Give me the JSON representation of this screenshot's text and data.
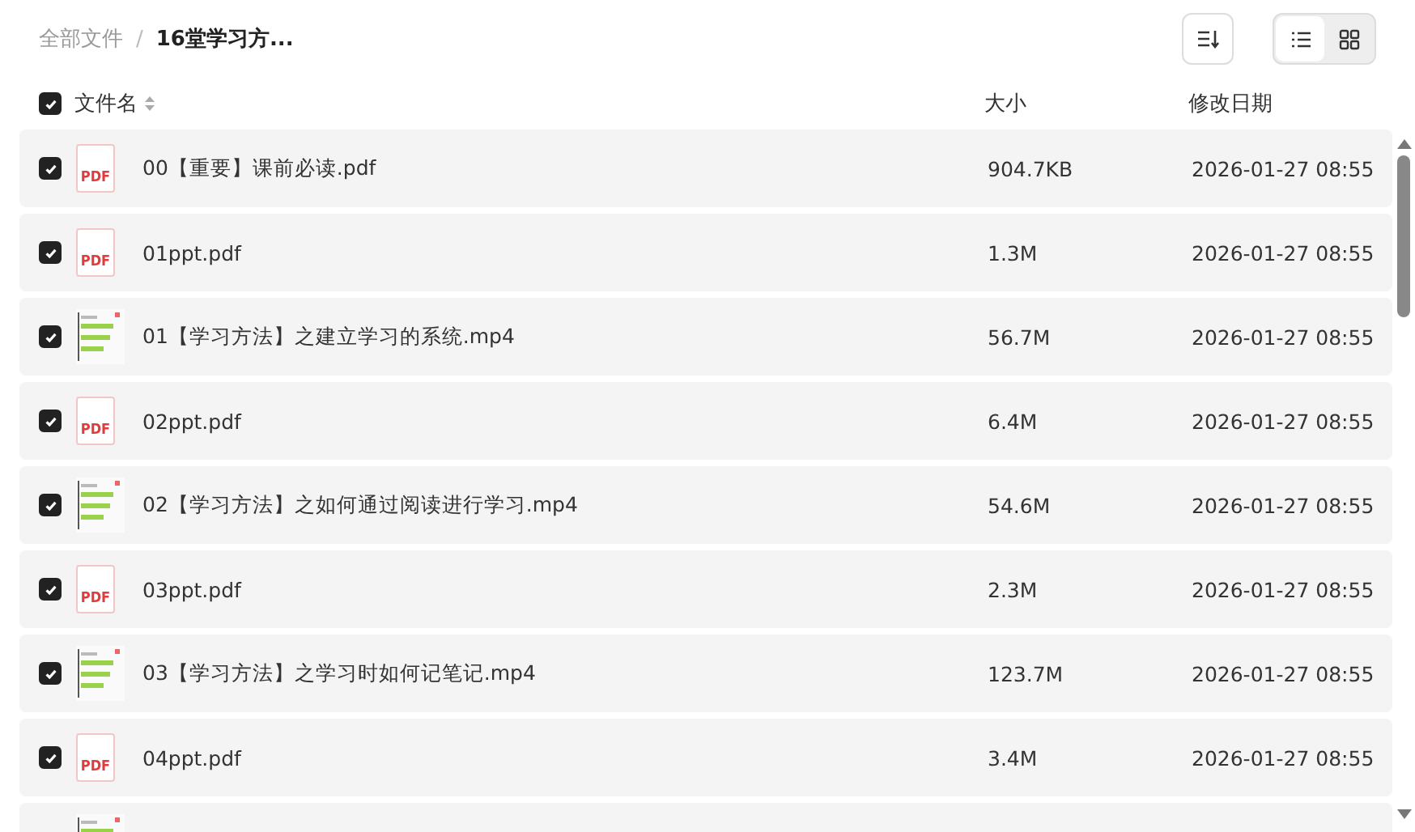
{
  "breadcrumb_separator": "/",
  "breadcrumb": [
    {
      "label": "全部文件",
      "current": false
    },
    {
      "label": "16堂学习方...",
      "current": true
    }
  ],
  "toolbar": {
    "view_modes": [
      {
        "kind": "list",
        "selected": true
      },
      {
        "kind": "grid",
        "selected": false
      }
    ]
  },
  "columns": {
    "select_all_checked": true,
    "name": "文件名",
    "size": "大小",
    "date": "修改日期"
  },
  "files": [
    {
      "kind": "pdf",
      "icon_label": "PDF",
      "name": "00【重要】课前必读.pdf",
      "size": "904.7KB",
      "date": "2026-01-27 08:55",
      "checked": true
    },
    {
      "kind": "pdf",
      "icon_label": "PDF",
      "name": "01ppt.pdf",
      "size": "1.3M",
      "date": "2026-01-27 08:55",
      "checked": true
    },
    {
      "kind": "video",
      "name": "01【学习方法】之建立学习的系统.mp4",
      "size": "56.7M",
      "date": "2026-01-27 08:55",
      "checked": true
    },
    {
      "kind": "pdf",
      "icon_label": "PDF",
      "name": "02ppt.pdf",
      "size": "6.4M",
      "date": "2026-01-27 08:55",
      "checked": true
    },
    {
      "kind": "video",
      "name": "02【学习方法】之如何通过阅读进行学习.mp4",
      "size": "54.6M",
      "date": "2026-01-27 08:55",
      "checked": true
    },
    {
      "kind": "pdf",
      "icon_label": "PDF",
      "name": "03ppt.pdf",
      "size": "2.3M",
      "date": "2026-01-27 08:55",
      "checked": true
    },
    {
      "kind": "video",
      "name": "03【学习方法】之学习时如何记笔记.mp4",
      "size": "123.7M",
      "date": "2026-01-27 08:55",
      "checked": true
    },
    {
      "kind": "pdf",
      "icon_label": "PDF",
      "name": "04ppt.pdf",
      "size": "3.4M",
      "date": "2026-01-27 08:55",
      "checked": true
    },
    {
      "kind": "video"
    }
  ]
}
